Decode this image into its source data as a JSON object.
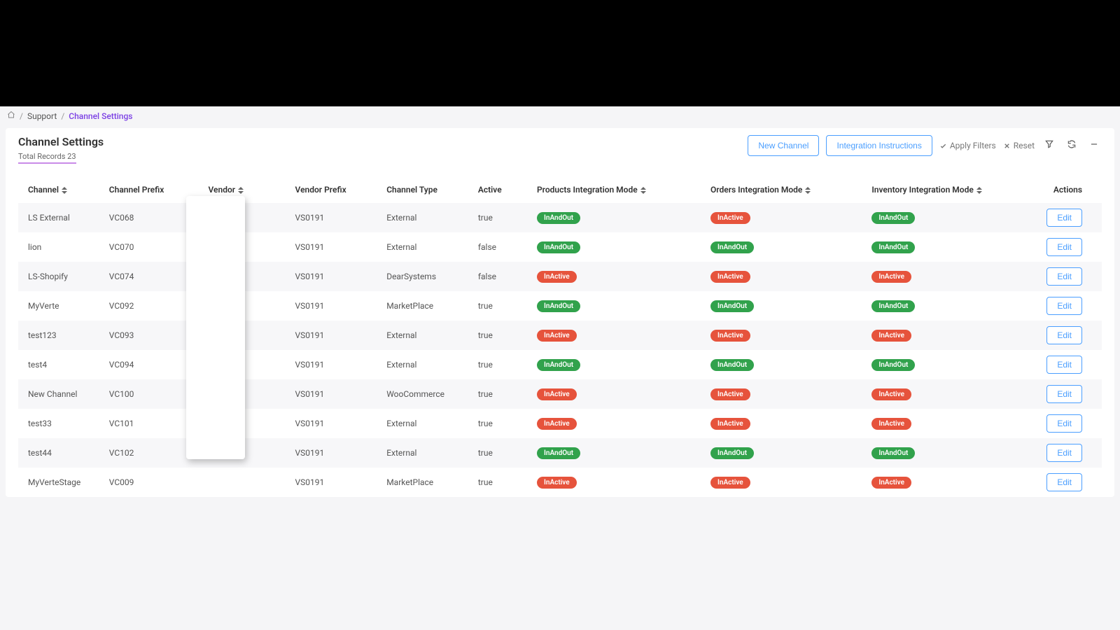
{
  "breadcrumb": {
    "home": "Home",
    "support": "Support",
    "current": "Channel Settings"
  },
  "header": {
    "title": "Channel Settings",
    "subtitle": "Total Records 23",
    "new_channel": "New Channel",
    "integration_instructions": "Integration Instructions",
    "apply_filters": "Apply Filters",
    "reset": "Reset"
  },
  "columns": {
    "channel": "Channel",
    "channel_prefix": "Channel Prefix",
    "vendor": "Vendor",
    "vendor_prefix": "Vendor Prefix",
    "channel_type": "Channel Type",
    "active": "Active",
    "products_mode": "Products Integration Mode",
    "orders_mode": "Orders Integration Mode",
    "inventory_mode": "Inventory Integration Mode",
    "actions": "Actions"
  },
  "edit_label": "Edit",
  "badges": {
    "inandout": "InAndOut",
    "inactive": "InActive"
  },
  "rows": [
    {
      "channel": "LS External",
      "prefix": "VC068",
      "vendor_prefix": "VS0191",
      "type": "External",
      "active": "true",
      "p": "InAndOut",
      "o": "InActive",
      "i": "InAndOut"
    },
    {
      "channel": "lion",
      "prefix": "VC070",
      "vendor_prefix": "VS0191",
      "type": "External",
      "active": "false",
      "p": "InAndOut",
      "o": "InAndOut",
      "i": "InAndOut"
    },
    {
      "channel": "LS-Shopify",
      "prefix": "VC074",
      "vendor_prefix": "VS0191",
      "type": "DearSystems",
      "active": "false",
      "p": "InActive",
      "o": "InActive",
      "i": "InActive"
    },
    {
      "channel": "MyVerte",
      "prefix": "VC092",
      "vendor_prefix": "VS0191",
      "type": "MarketPlace",
      "active": "true",
      "p": "InAndOut",
      "o": "InAndOut",
      "i": "InAndOut"
    },
    {
      "channel": "test123",
      "prefix": "VC093",
      "vendor_prefix": "VS0191",
      "type": "External",
      "active": "true",
      "p": "InActive",
      "o": "InActive",
      "i": "InActive"
    },
    {
      "channel": "test4",
      "prefix": "VC094",
      "vendor_prefix": "VS0191",
      "type": "External",
      "active": "true",
      "p": "InAndOut",
      "o": "InAndOut",
      "i": "InAndOut"
    },
    {
      "channel": "New Channel",
      "prefix": "VC100",
      "vendor_prefix": "VS0191",
      "type": "WooCommerce",
      "active": "true",
      "p": "InActive",
      "o": "InActive",
      "i": "InActive"
    },
    {
      "channel": "test33",
      "prefix": "VC101",
      "vendor_prefix": "VS0191",
      "type": "External",
      "active": "true",
      "p": "InActive",
      "o": "InActive",
      "i": "InActive"
    },
    {
      "channel": "test44",
      "prefix": "VC102",
      "vendor_prefix": "VS0191",
      "type": "External",
      "active": "true",
      "p": "InAndOut",
      "o": "InAndOut",
      "i": "InAndOut"
    },
    {
      "channel": "MyVerteStage",
      "prefix": "VC009",
      "vendor_prefix": "VS0191",
      "type": "MarketPlace",
      "active": "true",
      "p": "InActive",
      "o": "InActive",
      "i": "InActive"
    }
  ]
}
